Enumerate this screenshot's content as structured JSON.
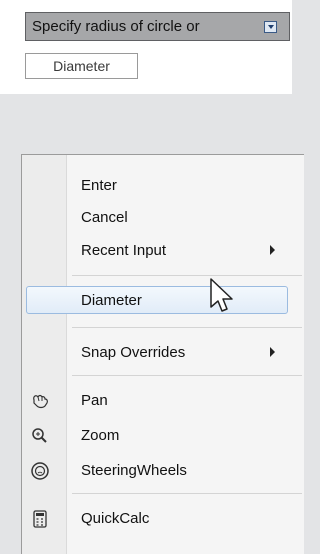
{
  "prompt": {
    "text": "Specify radius of circle or",
    "dropdown_icon": "down-arrow-icon"
  },
  "input": {
    "value": "Diameter"
  },
  "menu": {
    "items": [
      {
        "label": "Enter"
      },
      {
        "label": "Cancel"
      },
      {
        "label": "Recent Input",
        "submenu": true
      },
      {
        "label": "Diameter",
        "highlighted": true
      },
      {
        "label": "Snap Overrides",
        "submenu": true
      },
      {
        "label": "Pan",
        "icon": "pan-hand-icon"
      },
      {
        "label": "Zoom",
        "icon": "zoom-magnifier-icon"
      },
      {
        "label": "SteeringWheels",
        "icon": "steering-wheel-icon"
      },
      {
        "label": "QuickCalc",
        "icon": "calculator-icon"
      }
    ]
  },
  "colors": {
    "highlight_border": "#9bbbe0",
    "tooltip_bg": "#a6a7a9"
  }
}
